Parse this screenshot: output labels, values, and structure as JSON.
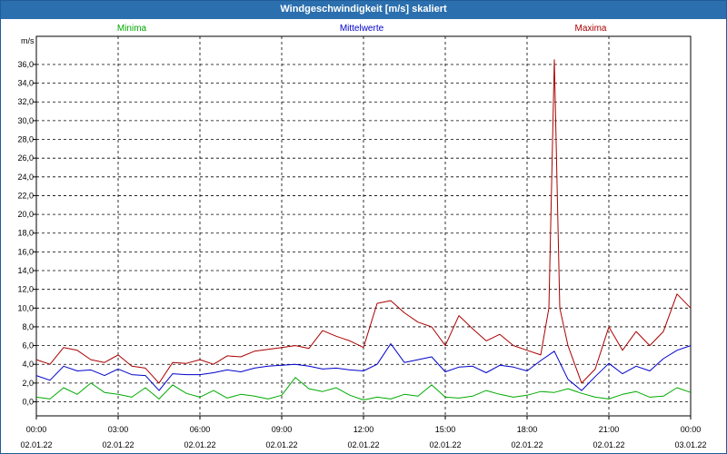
{
  "window": {
    "title": "Windgeschwindigkeit [m/s] skaliert"
  },
  "chart_data": {
    "type": "line",
    "title": "Windgeschwindigkeit [m/s] skaliert",
    "ylabel": "m/s",
    "xlabel": "",
    "ylim": [
      -1.5,
      39.0
    ],
    "yticks": [
      0.0,
      2.0,
      4.0,
      6.0,
      8.0,
      10.0,
      12.0,
      14.0,
      16.0,
      18.0,
      20.0,
      22.0,
      24.0,
      26.0,
      28.0,
      30.0,
      32.0,
      34.0,
      36.0
    ],
    "ytick_labels": [
      "0,0",
      "2,0",
      "4,0",
      "6,0",
      "8,0",
      "10,0",
      "12,0",
      "14,0",
      "16,0",
      "18,0",
      "20,0",
      "22,0",
      "24,0",
      "26,0",
      "28,0",
      "30,0",
      "32,0",
      "34,0",
      "36,0"
    ],
    "xlim": [
      0,
      24
    ],
    "xticks": [
      0,
      3,
      6,
      9,
      12,
      15,
      18,
      21,
      24
    ],
    "xtick_labels": [
      "00:00",
      "03:00",
      "06:00",
      "09:00",
      "12:00",
      "15:00",
      "18:00",
      "21:00",
      "00:00"
    ],
    "xtick_dates": [
      "02.01.22",
      "02.01.22",
      "02.01.22",
      "02.01.22",
      "02.01.22",
      "02.01.22",
      "02.01.22",
      "02.01.22",
      "03.01.22"
    ],
    "grid": true,
    "legend": "top",
    "series": [
      {
        "name": "Minima",
        "color": "#00aa00",
        "x": [
          0.0,
          0.5,
          1.0,
          1.5,
          2.0,
          2.5,
          3.0,
          3.5,
          4.0,
          4.5,
          5.0,
          5.5,
          6.0,
          6.5,
          7.0,
          7.5,
          8.0,
          8.5,
          9.0,
          9.5,
          10.0,
          10.5,
          11.0,
          11.5,
          12.0,
          12.5,
          13.0,
          13.5,
          14.0,
          14.5,
          15.0,
          15.5,
          16.0,
          16.5,
          17.0,
          17.5,
          18.0,
          18.5,
          19.0,
          19.5,
          20.0,
          20.5,
          21.0,
          21.5,
          22.0,
          22.5,
          23.0,
          23.5,
          24.0
        ],
        "values": [
          0.5,
          0.3,
          1.5,
          0.8,
          2.0,
          1.0,
          0.8,
          0.5,
          1.5,
          0.3,
          1.8,
          0.9,
          0.5,
          1.2,
          0.4,
          0.8,
          0.6,
          0.3,
          0.7,
          2.6,
          1.4,
          1.1,
          1.5,
          0.7,
          0.2,
          0.5,
          0.3,
          0.8,
          0.6,
          1.8,
          0.5,
          0.4,
          0.6,
          1.2,
          0.8,
          0.5,
          0.7,
          1.1,
          1.0,
          1.4,
          0.9,
          0.5,
          0.3,
          0.8,
          1.1,
          0.5,
          0.6,
          1.5,
          1.0
        ]
      },
      {
        "name": "Mittelwerte",
        "color": "#0000cc",
        "x": [
          0.0,
          0.5,
          1.0,
          1.5,
          2.0,
          2.5,
          3.0,
          3.5,
          4.0,
          4.5,
          5.0,
          5.5,
          6.0,
          6.5,
          7.0,
          7.5,
          8.0,
          8.5,
          9.0,
          9.5,
          10.0,
          10.5,
          11.0,
          11.5,
          12.0,
          12.5,
          13.0,
          13.5,
          14.0,
          14.5,
          15.0,
          15.5,
          16.0,
          16.5,
          17.0,
          17.5,
          18.0,
          18.5,
          19.0,
          19.5,
          20.0,
          20.5,
          21.0,
          21.5,
          22.0,
          22.5,
          23.0,
          23.5,
          24.0
        ],
        "values": [
          2.8,
          2.3,
          3.8,
          3.3,
          3.4,
          2.8,
          3.5,
          2.9,
          2.8,
          1.2,
          3.0,
          2.9,
          2.9,
          3.1,
          3.4,
          3.2,
          3.6,
          3.8,
          3.9,
          4.0,
          3.8,
          3.5,
          3.6,
          3.4,
          3.3,
          4.0,
          6.2,
          4.2,
          4.5,
          4.8,
          3.2,
          3.7,
          3.8,
          3.1,
          3.9,
          3.7,
          3.3,
          4.4,
          5.4,
          2.4,
          1.2,
          2.7,
          4.1,
          3.0,
          3.8,
          3.3,
          4.6,
          5.5,
          6.0
        ]
      },
      {
        "name": "Maxima",
        "color": "#aa0000",
        "x": [
          0.0,
          0.5,
          1.0,
          1.5,
          2.0,
          2.5,
          3.0,
          3.5,
          4.0,
          4.5,
          5.0,
          5.5,
          6.0,
          6.5,
          7.0,
          7.5,
          8.0,
          8.5,
          9.0,
          9.5,
          10.0,
          10.5,
          11.0,
          11.5,
          12.0,
          12.5,
          13.0,
          13.5,
          14.0,
          14.5,
          15.0,
          15.5,
          16.0,
          16.5,
          17.0,
          17.5,
          18.0,
          18.5,
          18.8,
          19.0,
          19.2,
          19.5,
          20.0,
          20.5,
          21.0,
          21.5,
          22.0,
          22.5,
          23.0,
          23.5,
          24.0
        ],
        "values": [
          4.5,
          4.0,
          5.8,
          5.5,
          4.5,
          4.2,
          5.0,
          3.8,
          3.6,
          2.0,
          4.2,
          4.1,
          4.5,
          4.0,
          4.9,
          4.8,
          5.4,
          5.6,
          5.8,
          6.0,
          5.7,
          7.6,
          7.0,
          6.5,
          5.8,
          10.5,
          10.8,
          9.5,
          8.5,
          8.0,
          6.0,
          9.2,
          7.8,
          6.5,
          7.2,
          6.0,
          5.5,
          5.0,
          10.0,
          36.5,
          10.0,
          6.0,
          2.0,
          3.5,
          8.0,
          5.5,
          7.5,
          6.0,
          7.5,
          11.5,
          10.0
        ]
      }
    ]
  }
}
